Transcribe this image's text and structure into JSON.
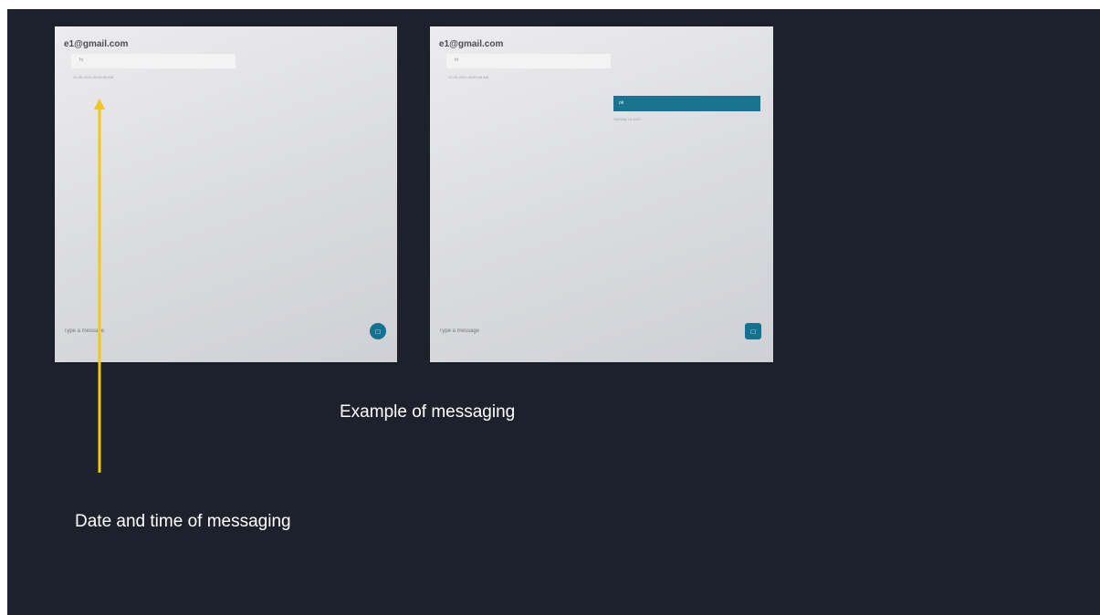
{
  "panels": [
    {
      "title": "e1@gmail.com",
      "incoming_message": "hi",
      "incoming_timestamp": "12-05-2021 09:53:26 AM",
      "compose_placeholder": "Type a message",
      "send_icon": "send-icon"
    },
    {
      "title": "e1@gmail.com",
      "incoming_message": "hi",
      "incoming_timestamp": "12-05-2021 09:53:26 AM",
      "outgoing_message": "ok",
      "outgoing_timestamp": "Sat May 15 2021",
      "compose_placeholder": "Type a message",
      "send_icon": "send-icon"
    }
  ],
  "annotations": {
    "example_caption": "Example of messaging",
    "date_caption": "Date and time of messaging"
  },
  "colors": {
    "slide_background": "#1d212b",
    "accent": "#16708f",
    "arrow": "#f2c71b"
  }
}
